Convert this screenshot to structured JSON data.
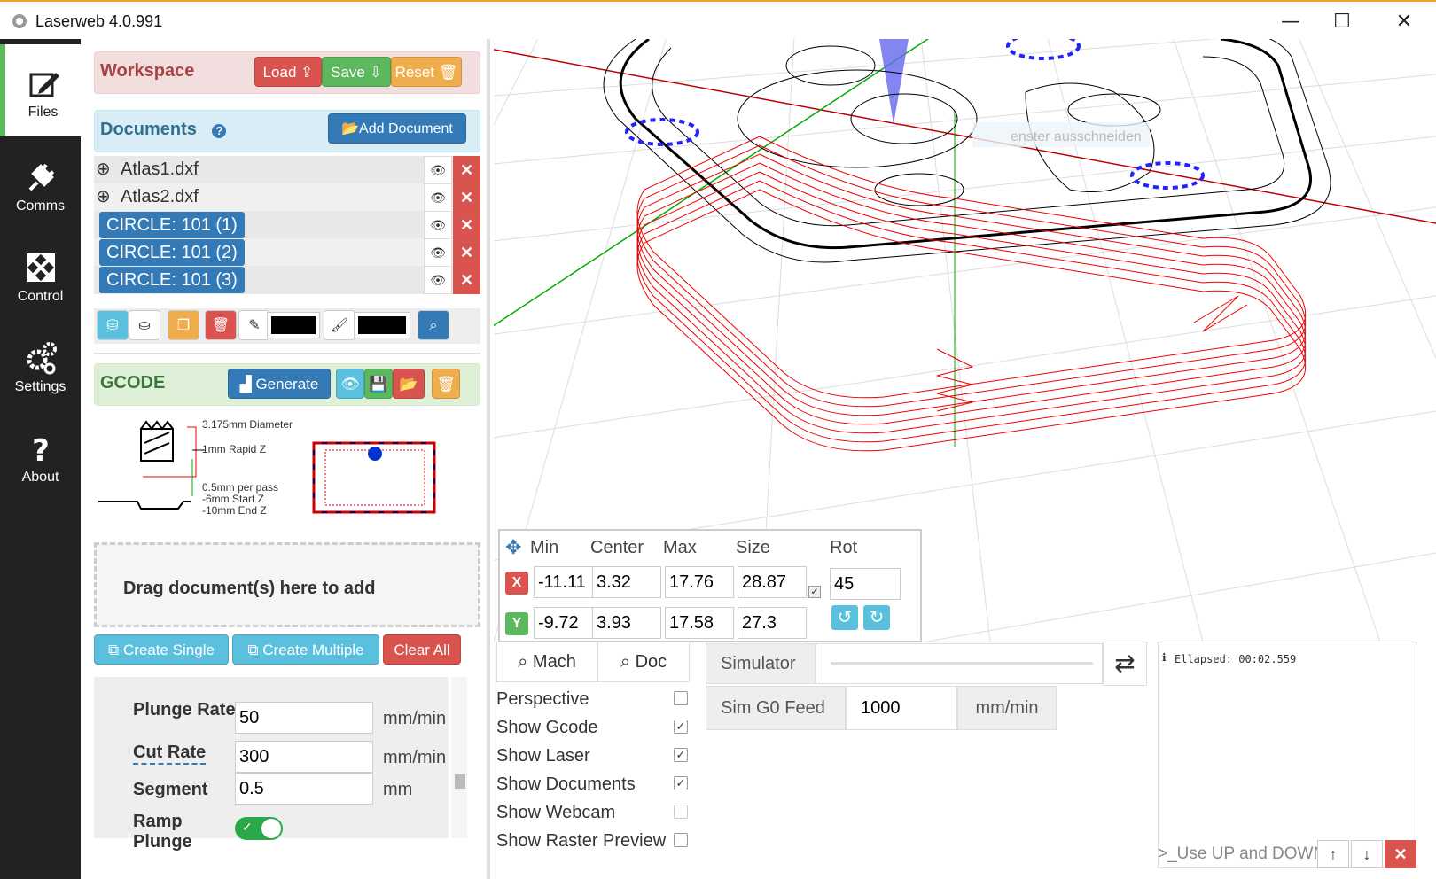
{
  "window": {
    "title": "Laserweb 4.0.991",
    "minimize": "—",
    "maximize": "☐",
    "close": "✕"
  },
  "nav": [
    {
      "label": "Files",
      "icon": "edit-icon"
    },
    {
      "label": "Comms",
      "icon": "plug-icon"
    },
    {
      "label": "Control",
      "icon": "arrows-icon"
    },
    {
      "label": "Settings",
      "icon": "gears-icon"
    },
    {
      "label": "About",
      "icon": "question-icon"
    }
  ],
  "workspace": {
    "title": "Workspace",
    "load": "Load",
    "save": "Save",
    "reset": "Reset"
  },
  "documents": {
    "title": "Documents",
    "help": "?",
    "add": "Add Document",
    "items": [
      {
        "name": "Atlas1.dxf",
        "type": "file"
      },
      {
        "name": "Atlas2.dxf",
        "type": "file"
      },
      {
        "name": "CIRCLE: 101 (1)",
        "type": "tag"
      },
      {
        "name": "CIRCLE: 101 (2)",
        "type": "tag"
      },
      {
        "name": "CIRCLE: 101 (3)",
        "type": "tag"
      }
    ]
  },
  "gcode": {
    "title": "GCODE",
    "generate": "Generate"
  },
  "diagram": {
    "diameter": "3.175mm Diameter",
    "rapid": "1mm Rapid Z",
    "pass": "0.5mm per pass",
    "start": "-6mm Start Z",
    "end": "-10mm End Z"
  },
  "dropzone": "Drag document(s) here to add",
  "ops": {
    "single": "Create Single",
    "multiple": "Create Multiple",
    "clear": "Clear All"
  },
  "settings": [
    {
      "label": "Plunge Rate",
      "value": "50",
      "unit": "mm/min"
    },
    {
      "label": "Cut Rate",
      "value": "300",
      "unit": "mm/min"
    },
    {
      "label": "Segment",
      "value": "0.5",
      "unit": "mm"
    },
    {
      "label": "Ramp Plunge",
      "value": "on",
      "unit": ""
    }
  ],
  "dims": {
    "headers": {
      "min": "Min",
      "center": "Center",
      "max": "Max",
      "size": "Size",
      "rot": "Rot"
    },
    "x": {
      "label": "X",
      "min": "-11.11",
      "center": "3.32",
      "max": "17.76",
      "size": "28.87"
    },
    "y": {
      "label": "Y",
      "min": "-9.72",
      "center": "3.93",
      "max": "17.58",
      "size": "27.3"
    },
    "rot": "45"
  },
  "view": {
    "mach": "Mach",
    "doc": "Doc"
  },
  "checks": [
    {
      "label": "Perspective",
      "checked": false
    },
    {
      "label": "Show Gcode",
      "checked": true
    },
    {
      "label": "Show Laser",
      "checked": true
    },
    {
      "label": "Show Documents",
      "checked": true
    },
    {
      "label": "Show Webcam",
      "checked": false
    },
    {
      "label": "Show Raster Preview",
      "checked": false
    }
  ],
  "simulator": {
    "label": "Simulator",
    "feed_label": "Sim G0 Feed",
    "feed_value": "1000",
    "feed_unit": "mm/min"
  },
  "log": {
    "elapsed": "Ellapsed: 00:02.559",
    "placeholder": "_Use UP and DOWN arrows"
  },
  "viewport_hint": "enster ausschneiden",
  "colors": {
    "red": "#d9534f",
    "green": "#5cb85c",
    "orange": "#f0ad4e",
    "blue": "#337ab7",
    "cyan": "#5bc0de",
    "nav": "#222222"
  }
}
